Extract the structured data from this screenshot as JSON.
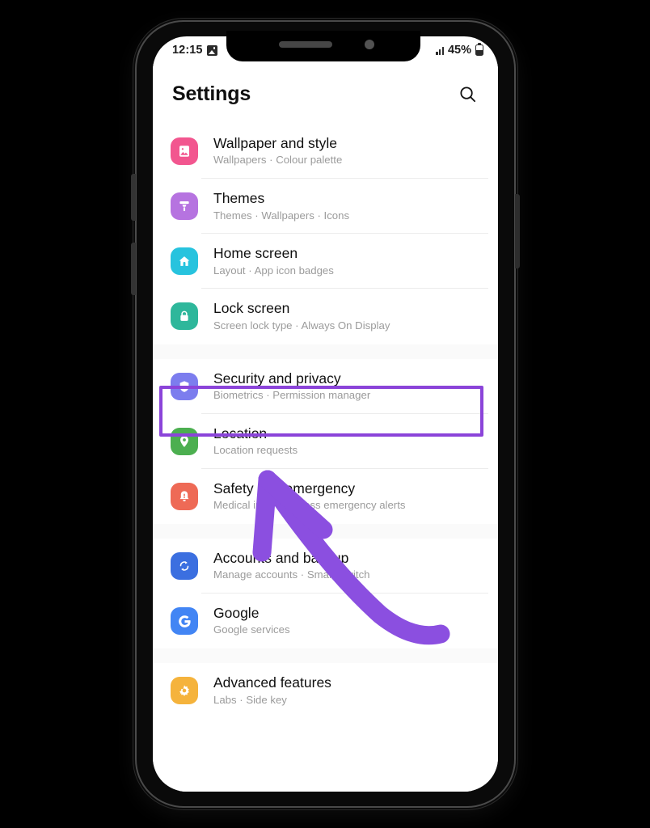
{
  "device": {
    "notch": {
      "speaker_icon": "speaker-grille",
      "camera_icon": "front-camera-dot"
    },
    "buttons": {
      "volume_up": "volume-up-button",
      "volume_down": "volume-down-button",
      "power": "power-button"
    }
  },
  "status_bar": {
    "time": "12:15",
    "gallery_icon": "gallery-icon",
    "signal_icon": "cellular-signal-icon",
    "battery_percent": "45%",
    "battery_icon": "battery-icon"
  },
  "header": {
    "title": "Settings",
    "search_icon": "search-icon"
  },
  "annotations": {
    "highlight_color": "#8B44D9",
    "highlight_target": "Security and privacy",
    "arrow_color": "#8B4FE0",
    "arrow_points_to": "Location"
  },
  "settings": {
    "groups": [
      {
        "items": [
          {
            "title": "Wallpaper and style",
            "subtitle": "Wallpapers  ·  Colour palette",
            "icon": "wallpaper-icon",
            "icon_bg": "#F2568F"
          },
          {
            "title": "Themes",
            "subtitle": "Themes  ·  Wallpapers  ·  Icons",
            "icon": "themes-brush-icon",
            "icon_bg": "#B673E0"
          },
          {
            "title": "Home screen",
            "subtitle": "Layout  ·  App icon badges",
            "icon": "home-icon",
            "icon_bg": "#27C3DE"
          },
          {
            "title": "Lock screen",
            "subtitle": "Screen lock type  ·  Always On Display",
            "icon": "lock-icon",
            "icon_bg": "#2EB79B"
          }
        ]
      },
      {
        "items": [
          {
            "title": "Security and privacy",
            "subtitle": "Biometrics  ·  Permission manager",
            "icon": "shield-icon",
            "icon_bg": "#7C7DEE",
            "highlighted": true
          },
          {
            "title": "Location",
            "subtitle": "Location requests",
            "icon": "location-pin-icon",
            "icon_bg": "#4CAF50"
          },
          {
            "title": "Safety and emergency",
            "subtitle": "Medical info  ·  Wireless emergency alerts",
            "icon": "emergency-bell-icon",
            "icon_bg": "#EE6A56"
          }
        ]
      },
      {
        "items": [
          {
            "title": "Accounts and backup",
            "subtitle": "Manage accounts  ·  Smart Switch",
            "icon": "sync-accounts-icon",
            "icon_bg": "#3B6FE0"
          },
          {
            "title": "Google",
            "subtitle": "Google services",
            "icon": "google-g-icon",
            "icon_bg": "#4285F4"
          }
        ]
      },
      {
        "items": [
          {
            "title": "Advanced features",
            "subtitle": "Labs  ·  Side key",
            "icon": "advanced-features-icon",
            "icon_bg": "#F5B33C"
          }
        ]
      }
    ]
  }
}
